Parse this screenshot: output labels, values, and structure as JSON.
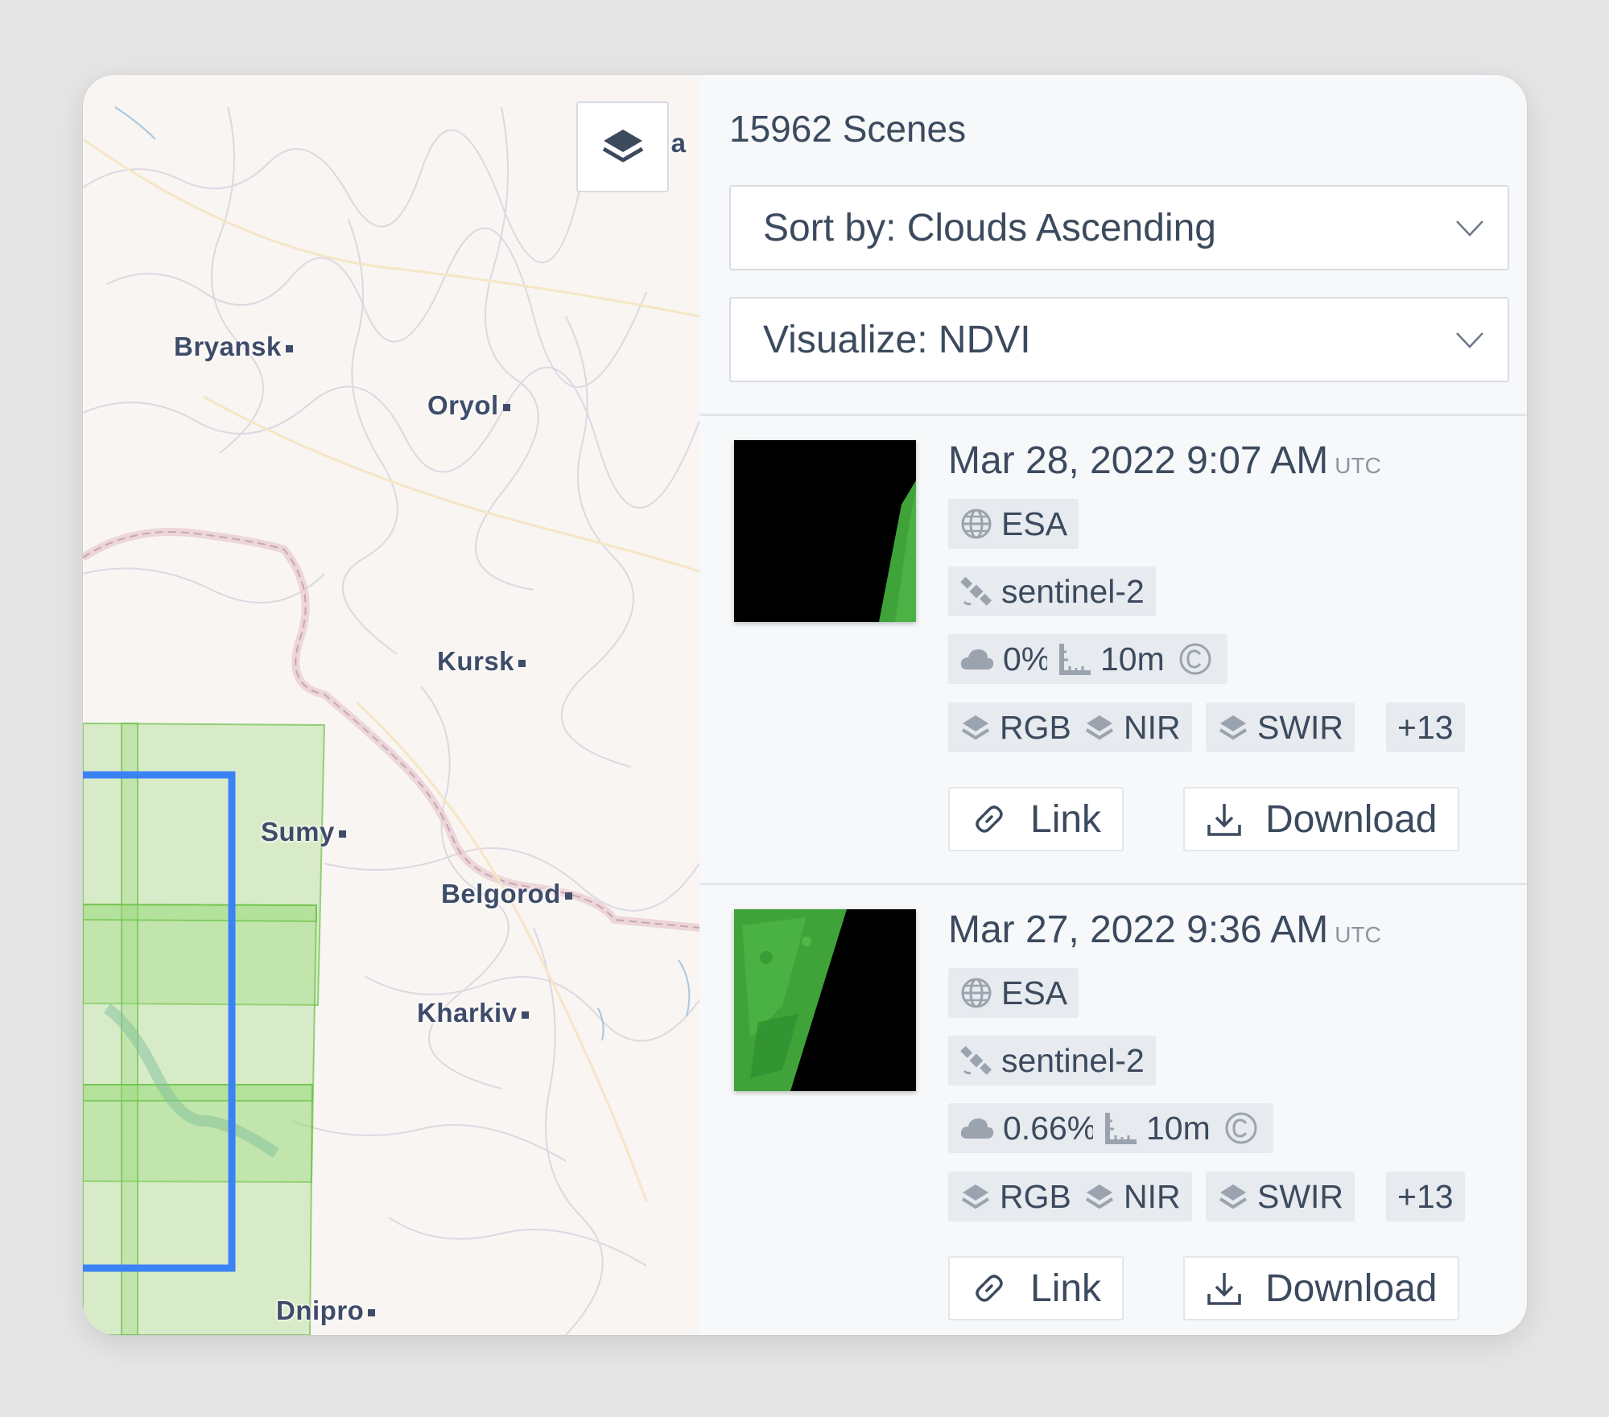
{
  "header": {
    "scene_count": "15962 Scenes"
  },
  "controls": {
    "sort_label": "Sort by: Clouds Ascending",
    "visualize_label": "Visualize: NDVI"
  },
  "map": {
    "cities": [
      "Bryansk",
      "Oryol",
      "Kursk",
      "Sumy",
      "Belgorod",
      "Kharkiv",
      "Dnipro"
    ],
    "partial_label": "la"
  },
  "scenes": [
    {
      "date": "Mar 28, 2022 9:07 AM",
      "tz": "UTC",
      "provider": "ESA",
      "satellite": "sentinel-2",
      "clouds": "0%",
      "resolution": "10m",
      "bands": [
        "RGB",
        "NIR",
        "SWIR"
      ],
      "more_bands": "+13",
      "link_label": "Link",
      "download_label": "Download"
    },
    {
      "date": "Mar 27, 2022 9:36 AM",
      "tz": "UTC",
      "provider": "ESA",
      "satellite": "sentinel-2",
      "clouds": "0.66%",
      "resolution": "10m",
      "bands": [
        "RGB",
        "NIR",
        "SWIR"
      ],
      "more_bands": "+13",
      "link_label": "Link",
      "download_label": "Download"
    }
  ],
  "colors": {
    "aoi_outline": "#3b82f6",
    "footprint_fill": "#9bd97c",
    "footprint_stroke": "#6cc24a",
    "ndvi_green": "#3fa33a"
  }
}
